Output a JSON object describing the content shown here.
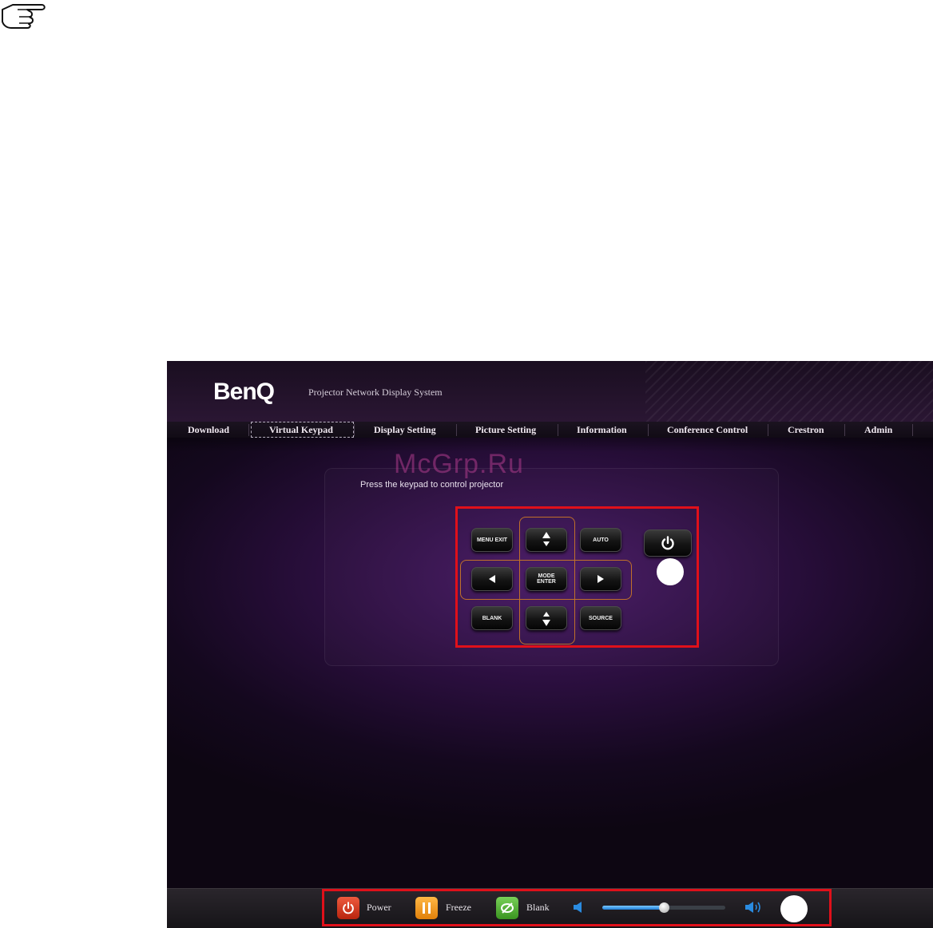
{
  "header": {
    "logo": "BenQ",
    "subtitle": "Projector Network Display System"
  },
  "nav": {
    "items": [
      {
        "label": "Download"
      },
      {
        "label": "Virtual Keypad",
        "active": true
      },
      {
        "label": "Display Setting"
      },
      {
        "label": "Picture Setting"
      },
      {
        "label": "Information"
      },
      {
        "label": "Conference Control"
      },
      {
        "label": "Crestron"
      },
      {
        "label": "Admin"
      }
    ]
  },
  "watermark": "McGrp.Ru",
  "keypad": {
    "instruction": "Press the keypad to control projector",
    "menu_label": "MENU EXIT",
    "auto_label": "AUTO",
    "mode_label": "MODE ENTER",
    "blank_label": "BLANK",
    "source_label": "SOURCE"
  },
  "bottombar": {
    "power_label": "Power",
    "freeze_label": "Freeze",
    "blank_label": "Blank",
    "volume_level": 0.5
  },
  "colors": {
    "highlight": "#e0101a",
    "dpad_outline": "#c0702a",
    "power": "#d8371f",
    "freeze": "#f29a1e",
    "blank": "#58b43a",
    "volume": "#2a8be0"
  }
}
